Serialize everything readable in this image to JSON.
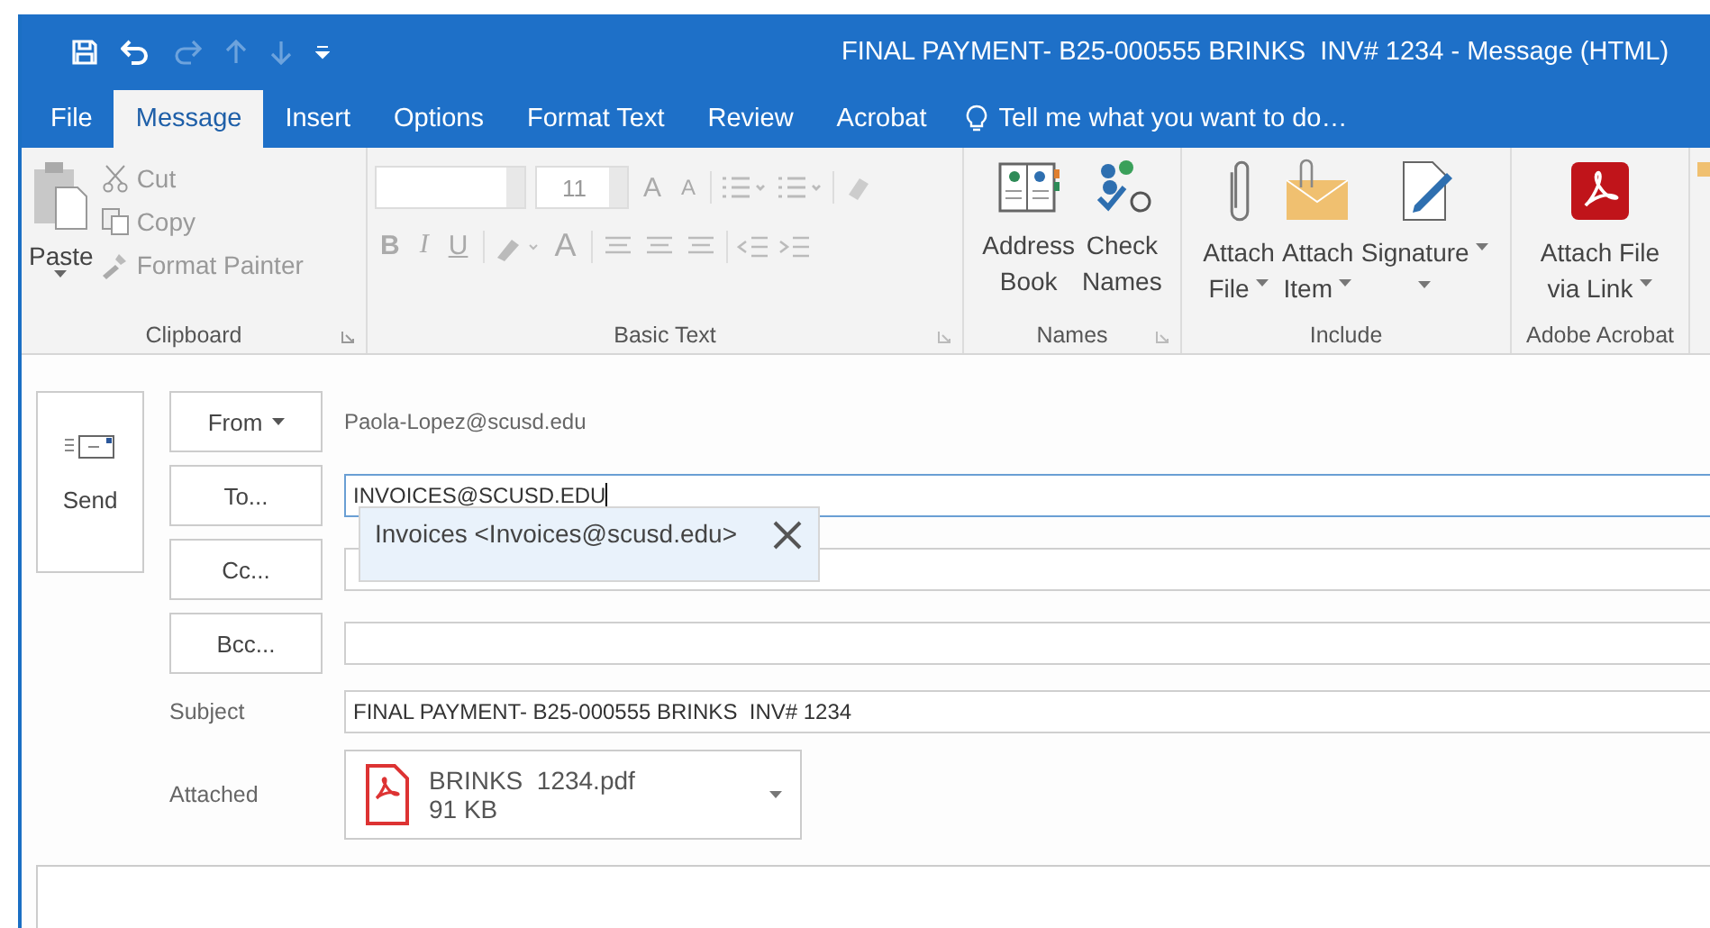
{
  "quick_access": [
    {
      "kind": "save",
      "disabled": false
    },
    {
      "kind": "undo",
      "disabled": false
    },
    {
      "kind": "redo",
      "disabled": true
    },
    {
      "kind": "up",
      "disabled": true
    },
    {
      "kind": "down",
      "disabled": true
    },
    {
      "kind": "customize",
      "disabled": false
    }
  ],
  "window": {
    "title": "FINAL PAYMENT- B25-000555 BRINKS  INV# 1234 - Message (HTML)"
  },
  "tabs": [
    {
      "label": "File",
      "selected": false
    },
    {
      "label": "Message",
      "selected": true
    },
    {
      "label": "Insert",
      "selected": false
    },
    {
      "label": "Options",
      "selected": false
    },
    {
      "label": "Format Text",
      "selected": false
    },
    {
      "label": "Review",
      "selected": false
    },
    {
      "label": "Acrobat",
      "selected": false
    }
  ],
  "tell_me": {
    "placeholder": "Tell me what you want to do…"
  },
  "clipboard": {
    "label": "Clipboard",
    "paste": "Paste",
    "items": [
      {
        "kind": "cut",
        "label": "Cut",
        "disabled": true
      },
      {
        "kind": "copy",
        "label": "Copy",
        "disabled": true
      },
      {
        "kind": "painter",
        "label": "Format Painter",
        "disabled": true
      }
    ]
  },
  "basic_text": {
    "label": "Basic Text",
    "disabled": true,
    "font_size": "11",
    "grow": "A",
    "shrink": "A",
    "styles": [
      "B",
      "I",
      "U"
    ],
    "font_color": "A"
  },
  "names": {
    "label": "Names",
    "buttons": [
      {
        "kind": "book",
        "lines": [
          "Address",
          "Book"
        ],
        "dropdown": false
      },
      {
        "kind": "check",
        "lines": [
          "Check",
          "Names"
        ],
        "dropdown": false
      }
    ]
  },
  "include": {
    "label": "Include",
    "buttons": [
      {
        "kind": "clip",
        "lines": [
          "Attach",
          "File"
        ],
        "dropdown": true
      },
      {
        "kind": "envelope",
        "lines": [
          "Attach",
          "Item"
        ],
        "dropdown": true
      },
      {
        "kind": "signature",
        "lines": [
          "Signature"
        ],
        "dropdown": true
      }
    ]
  },
  "acrobat": {
    "label": "Adobe Acrobat",
    "buttons": [
      {
        "kind": "pdf",
        "lines": [
          "Attach File",
          "via Link"
        ],
        "dropdown": true
      }
    ]
  },
  "send": {
    "label": "Send"
  },
  "from": {
    "label": "From",
    "value": "Paola-Lopez@scusd.edu"
  },
  "recipients": [
    {
      "label": "To...",
      "value": "INVOICES@SCUSD.EDU",
      "focused": true
    },
    {
      "label": "Cc...",
      "focused": false
    },
    {
      "label": "Bcc...",
      "focused": false
    }
  ],
  "subject": {
    "label": "Subject",
    "value": "FINAL PAYMENT- B25-000555 BRINKS  INV# 1234"
  },
  "attached": {
    "label": "Attached",
    "files": [
      {
        "name": "BRINKS  1234.pdf",
        "size": "91 KB"
      }
    ]
  },
  "suggestion": {
    "text": "Invoices <Invoices@scusd.edu>"
  }
}
